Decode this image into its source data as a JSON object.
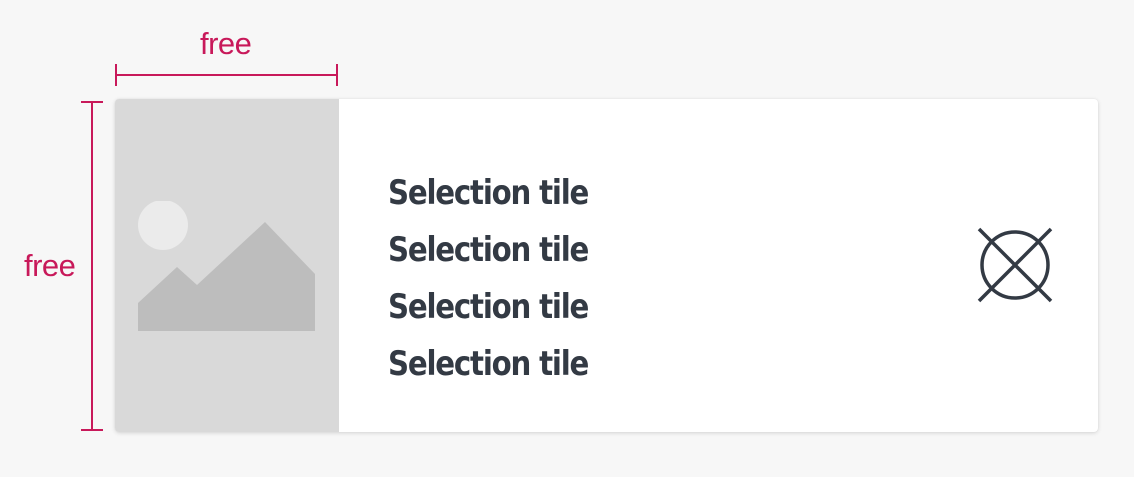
{
  "annotations": {
    "width_label": "free",
    "height_label": "free",
    "accent_color": "#c8195a"
  },
  "tile": {
    "image_icon": "image-placeholder-icon",
    "lines": [
      "Selection tile",
      "Selection tile",
      "Selection tile",
      "Selection tile"
    ],
    "indicator_icon": "circle-x-icon",
    "text_color": "#333a44"
  }
}
